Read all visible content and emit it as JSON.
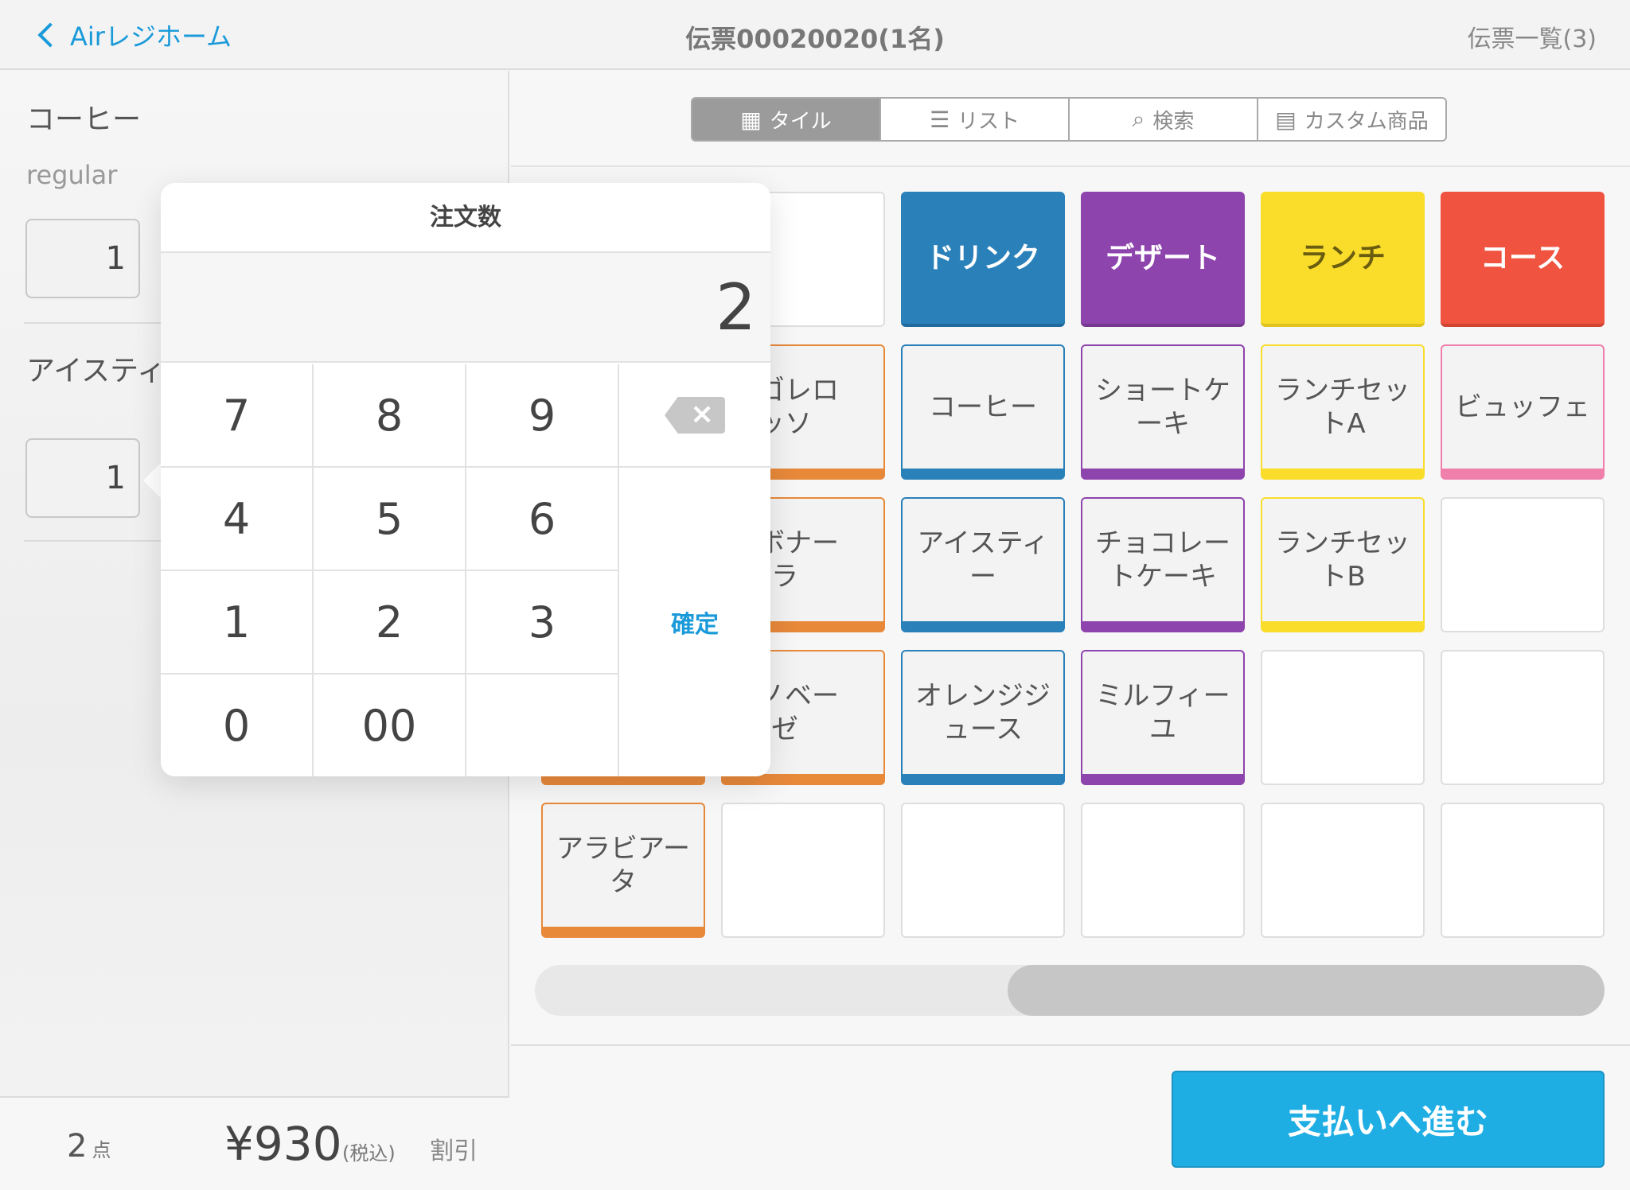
{
  "header": {
    "back_label": "Airレジホーム",
    "title": "伝票00020020(1名)",
    "right_link": "伝票一覧(3)"
  },
  "order_items": [
    {
      "name": "コーヒー",
      "variant": "regular",
      "qty": "1"
    },
    {
      "name": "アイスティー",
      "qty": "1"
    }
  ],
  "footer": {
    "count": "2",
    "count_unit": "点",
    "total": "¥930",
    "tax_note": "(税込)",
    "discount_label": "割引"
  },
  "segments": [
    {
      "label": "タイル",
      "icon": "grid-icon",
      "active": true
    },
    {
      "label": "リスト",
      "icon": "list-icon",
      "active": false
    },
    {
      "label": "検索",
      "icon": "search-icon",
      "active": false
    },
    {
      "label": "カスタム商品",
      "icon": "calculator-icon",
      "active": false
    }
  ],
  "tiles": {
    "row0": [
      "",
      "ドリンク",
      "デザート",
      "ランチ",
      "コース"
    ],
    "row1": [
      "",
      "ボンゴレロッソ",
      "コーヒー",
      "ショートケーキ",
      "ランチセットA",
      "ビュッフェ"
    ],
    "row2": [
      "",
      "カルボナーラ",
      "アイスティー",
      "チョコレートケーキ",
      "ランチセットB",
      ""
    ],
    "row3": [
      "",
      "ジェノベーゼ",
      "オレンジジュース",
      "ミルフィーユ",
      "",
      ""
    ],
    "row4": [
      "アラビアータ",
      "",
      "",
      "",
      "",
      ""
    ],
    "tile1_1_text": "ンゴレロ\nッソ",
    "tile2_1_text": "ルボナー\nラ",
    "tile3_1_text": "ェノベー\nゼ",
    "cat_drink": "ドリンク",
    "cat_dessert": "デザート",
    "cat_lunch": "ランチ",
    "cat_course": "コース",
    "coffee": "コーヒー",
    "shortcake": "ショートケ\nーキ",
    "lunchA": "ランチセッ\nトA",
    "buffet": "ビュッフェ",
    "icetea": "アイスティ\nー",
    "chococake": "チョコレー\nトケーキ",
    "lunchB": "ランチセッ\nトB",
    "orange": "オレンジジ\nュース",
    "millefeuille": "ミルフィー\nユ",
    "arrabbiata": "アラビアー\nタ"
  },
  "colors": {
    "accent": "#1a9ad9",
    "drink": "#2a80b9",
    "dessert": "#8e44ad",
    "lunch": "#f9dd2a",
    "course": "#f0533f",
    "pasta": "#e8893a",
    "pink": "#f07fab",
    "pay_button": "#1faee4"
  },
  "pay_button": "支払いへ進む",
  "keypad": {
    "title": "注文数",
    "display": "2",
    "keys": [
      "7",
      "8",
      "9",
      "4",
      "5",
      "6",
      "1",
      "2",
      "3",
      "0",
      "00"
    ],
    "confirm": "確定",
    "backspace_icon": "backspace-icon"
  }
}
